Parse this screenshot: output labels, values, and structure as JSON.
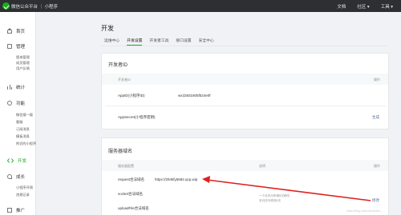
{
  "topbar": {
    "app_title": "微信公众平台 ｜ 小程序",
    "nav": [
      "文档",
      "社区 ▾",
      "工具 ▾"
    ]
  },
  "sidebar": {
    "sections": [
      {
        "label": "首页",
        "icon": "home-icon"
      },
      {
        "label": "管理",
        "icon": "management-icon",
        "items": [
          "版本管理",
          "成员管理",
          "用户反馈"
        ]
      },
      {
        "label": "统计",
        "icon": "statistics-icon"
      },
      {
        "label": "功能",
        "icon": "function-icon",
        "items": [
          "微信搜一搜",
          "客服",
          "订阅消息",
          "模板消息",
          "附近的小程序"
        ]
      },
      {
        "label": "开发",
        "icon": "development-icon"
      },
      {
        "label": "成长",
        "icon": "growth-icon",
        "items": [
          "小程序评测",
          "违规记录"
        ]
      },
      {
        "label": "推广",
        "icon": "promotion-icon"
      }
    ]
  },
  "page": {
    "title": "开发",
    "tabs": [
      "运维中心",
      "开发设置",
      "开发者工具",
      "接口设置",
      "安全中心"
    ],
    "active_tab": "开发设置"
  },
  "developer_id": {
    "title": "开发者ID",
    "header_left": "开发者ID",
    "header_right": "操作",
    "appid_label": "AppID(小程序ID)",
    "appid_value": "wx1b831805f524e0f",
    "secret_label": "AppSecret(小程序密钥)",
    "secret_action": "生成"
  },
  "server_domain": {
    "title": "服务器域名",
    "header_cols": [
      "服务器配置",
      "说明",
      "操作"
    ],
    "rows": [
      {
        "label": "request合法域名",
        "value": "https://294kfy5682.qcp.wip"
      },
      {
        "label": "socket合法域名",
        "value": ""
      },
      {
        "label": "uploadFile合法域名",
        "value": ""
      }
    ],
    "note_lines": [
      "一个月内可申请5次修改",
      "本月还可修改4次"
    ],
    "action": "修改"
  },
  "watermark": "https://blog.csdn.net/weixin_...",
  "colors": {
    "accent": "#1aad19",
    "topbar": "#2d2f33",
    "link": "#576b95",
    "arrow": "#e02020"
  }
}
